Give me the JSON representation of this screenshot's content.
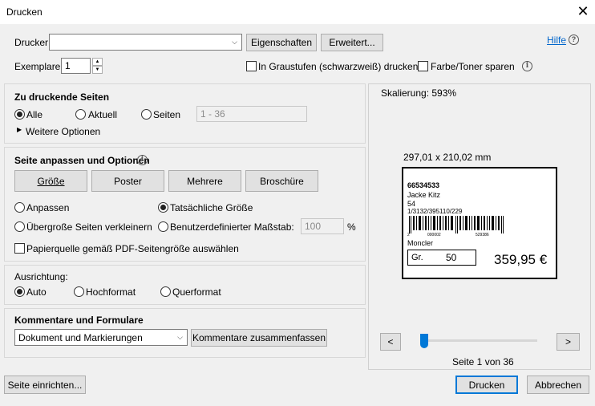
{
  "window": {
    "title": "Drucken",
    "close_glyph": "✕"
  },
  "top": {
    "printer_label": "Drucker:",
    "printer_value": "",
    "properties_button": "Eigenschaften",
    "advanced_button": "Erweitert...",
    "help_link": "Hilfe",
    "help_icon": "?",
    "copies_label": "Exemplare:",
    "copies_value": "1",
    "grayscale_label": "In Graustufen (schwarzweiß) drucken",
    "grayscale_checked": false,
    "save_ink_label": "Farbe/Toner sparen",
    "save_ink_checked": false
  },
  "pages": {
    "heading": "Zu druckende Seiten",
    "all_label": "Alle",
    "current_label": "Aktuell",
    "pages_label": "Seiten",
    "pages_range": "1 - 36",
    "more_options": "Weitere Optionen",
    "selected": "all"
  },
  "sizing": {
    "heading": "Seite anpassen und Optionen",
    "buttons": [
      "Größe",
      "Poster",
      "Mehrere",
      "Broschüre"
    ],
    "fit_label": "Anpassen",
    "actual_label": "Tatsächliche Größe",
    "shrink_label": "Übergroße Seiten verkleinern",
    "custom_label": "Benutzerdefinierter Maßstab:",
    "scale_value": "100",
    "percent": "%",
    "paper_source_label": "Papierquelle gemäß PDF-Seitengröße auswählen",
    "selected": "actual"
  },
  "orientation": {
    "heading": "Ausrichtung:",
    "auto_label": "Auto",
    "portrait_label": "Hochformat",
    "landscape_label": "Querformat",
    "selected": "auto"
  },
  "comments": {
    "heading": "Kommentare und Formulare",
    "select_value": "Dokument und Markierungen",
    "summarize_button": "Kommentare zusammenfassen"
  },
  "preview": {
    "scaling": "Skalierung: 593%",
    "page_size": "297,01 x 210,02 mm",
    "label_line1": "66534533",
    "label_line2": "Jacke Kitz",
    "label_line3": "54",
    "label_line4": "1/3132/395110/229",
    "barcode_digits_left": "2",
    "barcode_digits_mid": "000002",
    "barcode_digits_right": "529386",
    "brand": "Moncler",
    "size_prefix": "Gr.",
    "size_value": "50",
    "price": "359,95 €",
    "prev_button": "<",
    "next_button": ">",
    "page_indicator": "Seite 1 von 36",
    "slider_position": 0.0
  },
  "footer": {
    "page_setup_button": "Seite einrichten...",
    "print_button": "Drucken",
    "cancel_button": "Abbrechen"
  }
}
